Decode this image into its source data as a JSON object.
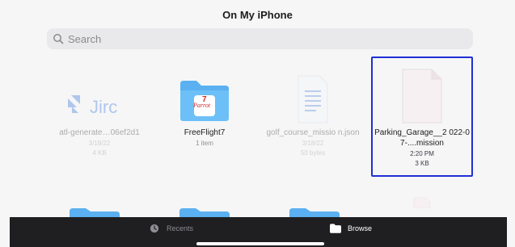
{
  "header": {
    "title": "On My iPhone"
  },
  "search": {
    "placeholder": "Search",
    "icon": "magnifying-glass-icon"
  },
  "files": [
    {
      "name": "atl-generate…06ef2d1",
      "date": "3/18/22",
      "size": "4 KB",
      "kind": "jirc-logo",
      "faded": true,
      "logo_text": "Jirc"
    },
    {
      "name": "FreeFlight7",
      "date": "",
      "size": "1 item",
      "kind": "folder",
      "faded": false,
      "logo_text": "Parrot"
    },
    {
      "name": "golf_course_missio n.json",
      "date": "3/18/22",
      "size": "50 bytes",
      "kind": "document",
      "faded": true
    },
    {
      "name": "Parking_Garage__2 022-07-....mission",
      "date": "2:20 PM",
      "size": "3 KB",
      "kind": "blank-document",
      "faded": false,
      "selected": true
    }
  ],
  "tabbar": {
    "recents_label": "Recents",
    "browse_label": "Browse",
    "recents_icon": "clock-icon",
    "browse_icon": "folder-icon",
    "active": "Browse"
  },
  "colors": {
    "selection": "#1f2fd6",
    "folder": "#5ab0f0",
    "tabbar_bg": "#1f1f21"
  }
}
